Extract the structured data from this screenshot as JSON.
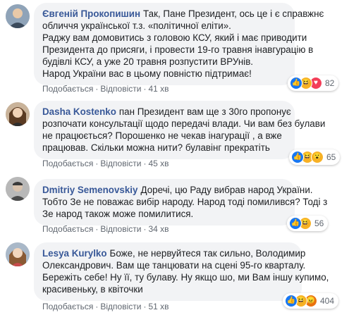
{
  "comments": [
    {
      "author": "Євгеній Прокопишин",
      "lines": [
        "Так, Пане Президент, ось це і є справжнє",
        "обличчя української т.з. «політичної еліти».",
        "Раджу вам домовитись з головою КСУ, який і має приводити",
        "Президента до присяги, і провести 19-го травня інавгурацію в",
        "будівлі КСУ, а уже 20 травня розпустити ВРУнів.",
        "Народ України вас в цьому повністю підтримає!"
      ],
      "like_label": "Подобається",
      "reply_label": "Відповісти",
      "time": "41 хв",
      "reactions": [
        "like",
        "laugh",
        "love"
      ],
      "reaction_count": "82"
    },
    {
      "author": "Dasha Kostenko",
      "lines": [
        "пан Президент вам ще з 30го пропонує",
        "розпочати консультації щодо передачі влади. Чи вам без булави",
        "не працюється? Порошенко не чекав інагурації , а вже",
        "працював. Скільки можна нити? булавінг прекратіть"
      ],
      "like_label": "Подобається",
      "reply_label": "Відповісти",
      "time": "45 хв",
      "reactions": [
        "like",
        "laugh",
        "wow"
      ],
      "reaction_count": "65"
    },
    {
      "author": "Dmitriy Semenovskiy",
      "lines": [
        "Доречі, цю Раду вибрав народ України.",
        "Тобто Зе не поважає вибір народу. Народ тоді помилився? Тоді з",
        "Зе народ також може помилитися."
      ],
      "like_label": "Подобається",
      "reply_label": "Відповісти",
      "time": "34 хв",
      "reactions": [
        "like",
        "laugh"
      ],
      "reaction_count": "56"
    },
    {
      "author": "Lesya Kurylko",
      "lines": [
        "Боже, не нервуйтеся так сильно, Володимир",
        "Олександрович. Вам ще танцювати на сцені 95-го кварталу.",
        "Бережіть себе! Ну її, ту булаву. Ну якщо шо, ми Вам іншу купимо,",
        "красивеньку, в квіточки"
      ],
      "like_label": "Подобається",
      "reply_label": "Відповісти",
      "time": "51 хв",
      "reactions": [
        "like",
        "laugh",
        "angry"
      ],
      "reaction_count": "404"
    }
  ],
  "colors": {
    "author": "#385898",
    "bubble": "#f2f3f5",
    "meta": "#606770"
  }
}
